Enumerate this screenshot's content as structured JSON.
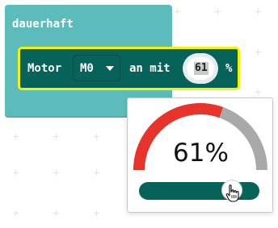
{
  "workspace": {
    "event_block": {
      "label": "dauerhaft",
      "color": "#5cbcbc"
    },
    "motor_block": {
      "label": "Motor",
      "motor_dropdown": {
        "selected": "M0"
      },
      "an_mit_label": "an mit",
      "speed_value": "61",
      "percent_label": "%",
      "color": "#07625a",
      "selection_outline_color": "#f2f202"
    }
  },
  "slider_popup": {
    "value_text": "61%",
    "value": 61,
    "gauge_colors": {
      "filled": "#e8332a",
      "empty": "#a9a9a9"
    },
    "track_color": "#07625a",
    "cursor_icon": "hand-pointer-icon"
  }
}
